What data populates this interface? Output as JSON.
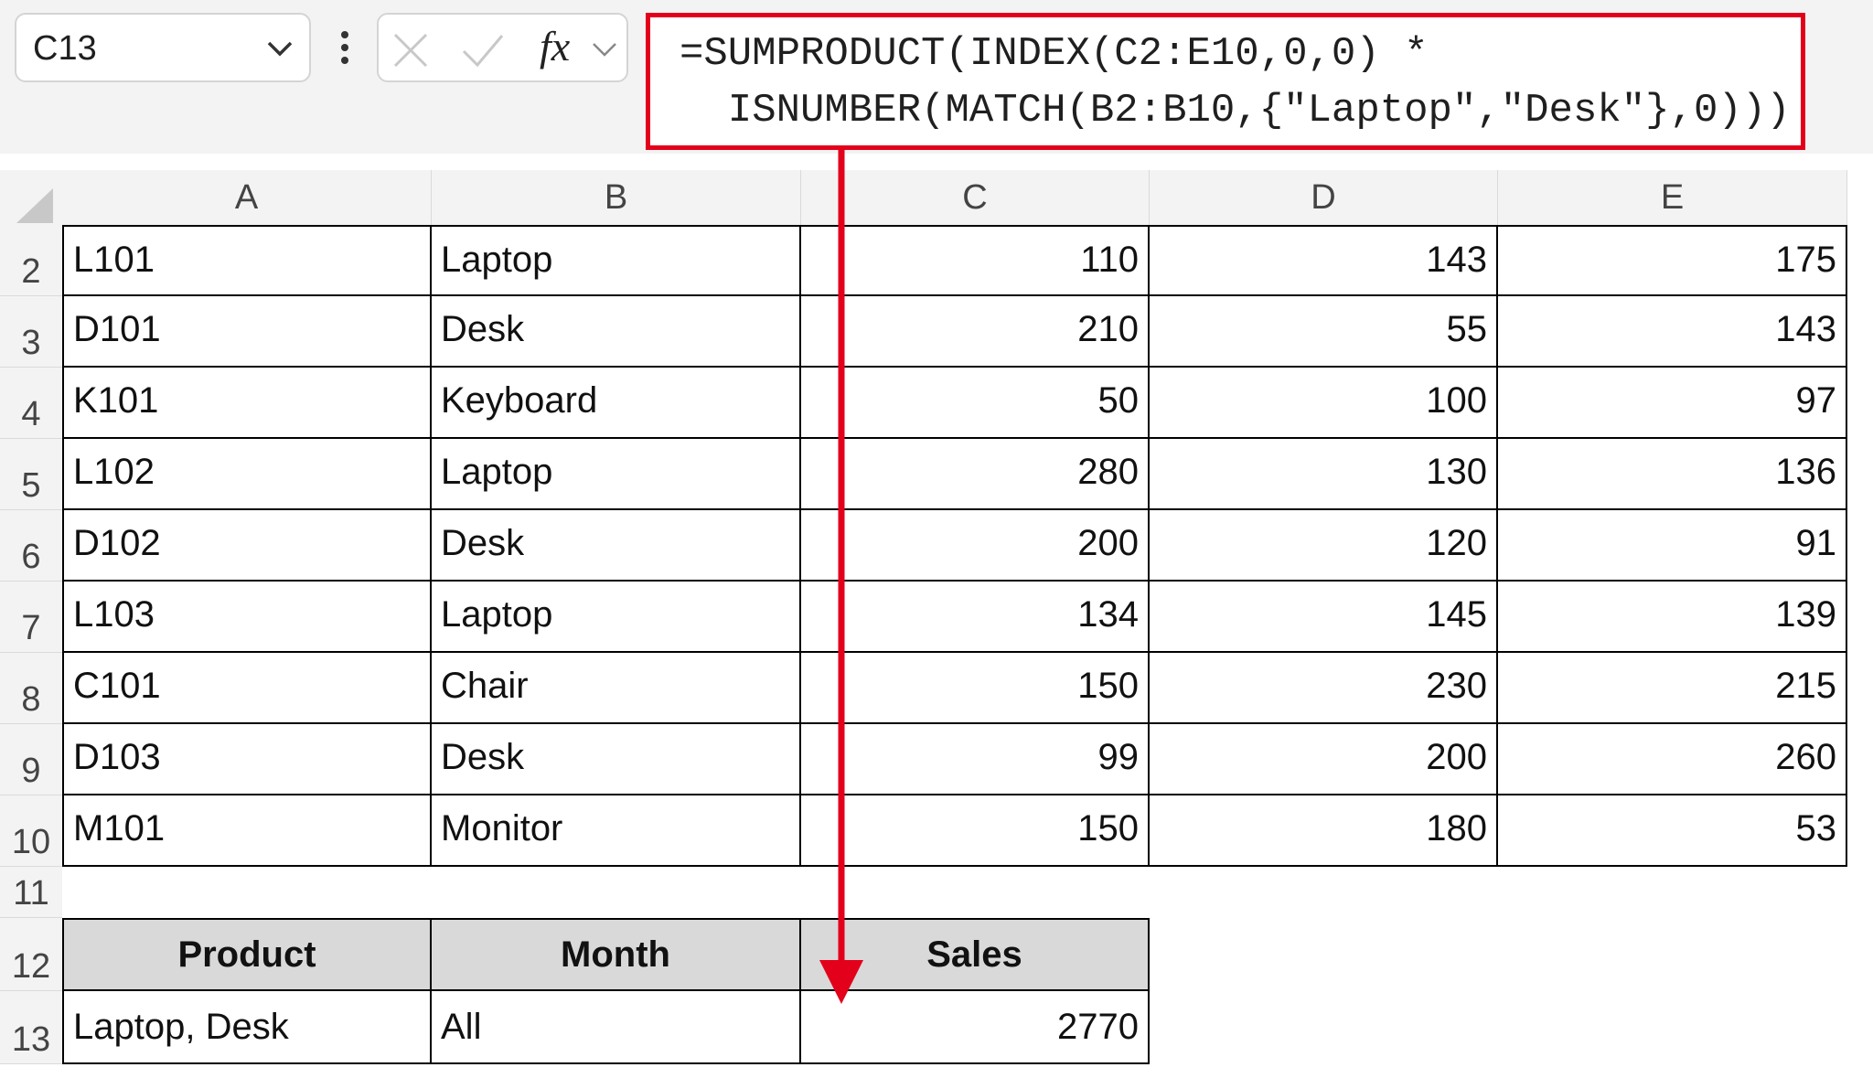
{
  "name_box": {
    "value": "C13"
  },
  "formula_bar": {
    "fx_label": "fx",
    "formula_line1": "=SUMPRODUCT(INDEX(C2:E10,0,0) *",
    "formula_line2": "  ISNUMBER(MATCH(B2:B10,{\"Laptop\",\"Desk\"},0)))"
  },
  "columns": [
    "A",
    "B",
    "C",
    "D",
    "E"
  ],
  "rows": [
    {
      "row": "2",
      "id": "L101",
      "product": "Laptop",
      "c": "110",
      "d": "143",
      "e": "175"
    },
    {
      "row": "3",
      "id": "D101",
      "product": "Desk",
      "c": "210",
      "d": "55",
      "e": "143"
    },
    {
      "row": "4",
      "id": "K101",
      "product": "Keyboard",
      "c": "50",
      "d": "100",
      "e": "97"
    },
    {
      "row": "5",
      "id": "L102",
      "product": "Laptop",
      "c": "280",
      "d": "130",
      "e": "136"
    },
    {
      "row": "6",
      "id": "D102",
      "product": "Desk",
      "c": "200",
      "d": "120",
      "e": "91"
    },
    {
      "row": "7",
      "id": "L103",
      "product": "Laptop",
      "c": "134",
      "d": "145",
      "e": "139"
    },
    {
      "row": "8",
      "id": "C101",
      "product": "Chair",
      "c": "150",
      "d": "230",
      "e": "215"
    },
    {
      "row": "9",
      "id": "D103",
      "product": "Desk",
      "c": "99",
      "d": "200",
      "e": "260"
    },
    {
      "row": "10",
      "id": "M101",
      "product": "Monitor",
      "c": "150",
      "d": "180",
      "e": "53"
    }
  ],
  "empty_row": "11",
  "summary": {
    "header_row": "12",
    "value_row": "13",
    "headers": {
      "product": "Product",
      "month": "Month",
      "sales": "Sales"
    },
    "values": {
      "product": "Laptop, Desk",
      "month": "All",
      "sales": "2770"
    }
  },
  "colors": {
    "highlight_red": "#e3001b",
    "header_fill": "#d9d9d9"
  }
}
